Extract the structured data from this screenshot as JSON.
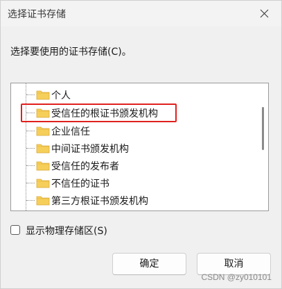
{
  "window": {
    "title": "选择证书存储",
    "close_icon": "close-icon"
  },
  "instruction": "选择要使用的证书存储(C)。",
  "stores": [
    {
      "label": "个人",
      "icon": "folder-icon"
    },
    {
      "label": "受信任的根证书颁发机构",
      "icon": "folder-icon",
      "highlighted": true
    },
    {
      "label": "企业信任",
      "icon": "folder-icon"
    },
    {
      "label": "中间证书颁发机构",
      "icon": "folder-icon"
    },
    {
      "label": "受信任的发布者",
      "icon": "folder-icon"
    },
    {
      "label": "不信任的证书",
      "icon": "folder-icon"
    },
    {
      "label": "第三方根证书颁发机构",
      "icon": "folder-icon"
    }
  ],
  "show_physical": {
    "label": "显示物理存储区(S)",
    "checked": false
  },
  "buttons": {
    "ok": "确定",
    "cancel": "取消"
  },
  "watermark": "CSDN @zy010101",
  "colors": {
    "highlight_border": "#e0201d",
    "folder_fill": "#f6cf5a",
    "folder_tab": "#e8b73e"
  }
}
